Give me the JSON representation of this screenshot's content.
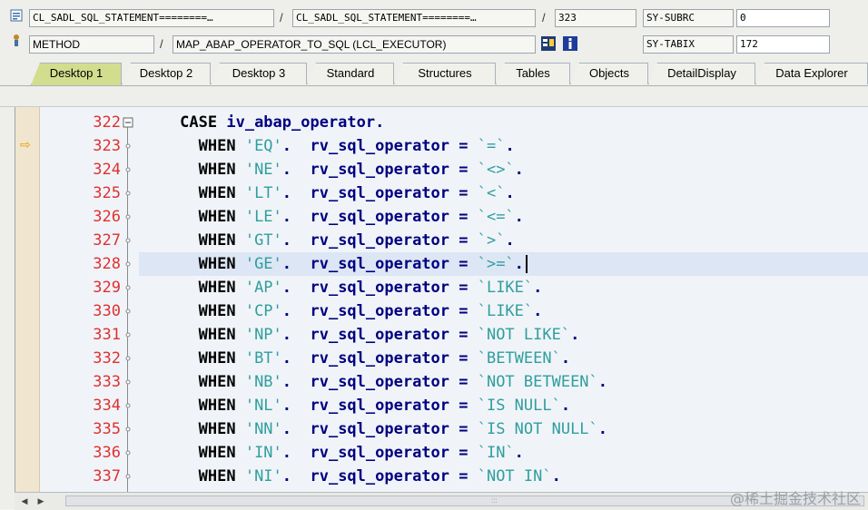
{
  "header": {
    "row1": {
      "program": "CL_SADL_SQL_STATEMENT========…",
      "include": "CL_SADL_SQL_STATEMENT========…",
      "line": "323",
      "var_name": "SY-SUBRC",
      "var_value": "0"
    },
    "row2": {
      "event_type": "METHOD",
      "event_name": "MAP_ABAP_OPERATOR_TO_SQL (LCL_EXECUTOR)",
      "var_name": "SY-TABIX",
      "var_value": "172"
    }
  },
  "tabs": [
    {
      "label": "Desktop 1",
      "active": true
    },
    {
      "label": "Desktop 2"
    },
    {
      "label": "Desktop 3"
    },
    {
      "label": "Standard"
    },
    {
      "label": "Structures"
    },
    {
      "label": "Tables"
    },
    {
      "label": "Objects"
    },
    {
      "label": "DetailDisplay"
    },
    {
      "label": "Data Explorer"
    }
  ],
  "code": {
    "lines": [
      {
        "num": "322",
        "pre": "CASE iv_abap_operator.",
        "lit": "",
        "post": ""
      },
      {
        "num": "323",
        "pre": "  WHEN ",
        "lit": "'EQ'",
        "post": ".  rv_sql_operator = ",
        "lit2": "`=`",
        "end": "."
      },
      {
        "num": "324",
        "pre": "  WHEN ",
        "lit": "'NE'",
        "post": ".  rv_sql_operator = ",
        "lit2": "`<>`",
        "end": "."
      },
      {
        "num": "325",
        "pre": "  WHEN ",
        "lit": "'LT'",
        "post": ".  rv_sql_operator = ",
        "lit2": "`<`",
        "end": "."
      },
      {
        "num": "326",
        "pre": "  WHEN ",
        "lit": "'LE'",
        "post": ".  rv_sql_operator = ",
        "lit2": "`<=`",
        "end": "."
      },
      {
        "num": "327",
        "pre": "  WHEN ",
        "lit": "'GT'",
        "post": ".  rv_sql_operator = ",
        "lit2": "`>`",
        "end": "."
      },
      {
        "num": "328",
        "pre": "  WHEN ",
        "lit": "'GE'",
        "post": ".  rv_sql_operator = ",
        "lit2": "`>=`",
        "end": "."
      },
      {
        "num": "329",
        "pre": "  WHEN ",
        "lit": "'AP'",
        "post": ".  rv_sql_operator = ",
        "lit2": "`LIKE`",
        "end": "."
      },
      {
        "num": "330",
        "pre": "  WHEN ",
        "lit": "'CP'",
        "post": ".  rv_sql_operator = ",
        "lit2": "`LIKE`",
        "end": "."
      },
      {
        "num": "331",
        "pre": "  WHEN ",
        "lit": "'NP'",
        "post": ".  rv_sql_operator = ",
        "lit2": "`NOT LIKE`",
        "end": "."
      },
      {
        "num": "332",
        "pre": "  WHEN ",
        "lit": "'BT'",
        "post": ".  rv_sql_operator = ",
        "lit2": "`BETWEEN`",
        "end": "."
      },
      {
        "num": "333",
        "pre": "  WHEN ",
        "lit": "'NB'",
        "post": ".  rv_sql_operator = ",
        "lit2": "`NOT BETWEEN`",
        "end": "."
      },
      {
        "num": "334",
        "pre": "  WHEN ",
        "lit": "'NL'",
        "post": ".  rv_sql_operator = ",
        "lit2": "`IS NULL`",
        "end": "."
      },
      {
        "num": "335",
        "pre": "  WHEN ",
        "lit": "'NN'",
        "post": ".  rv_sql_operator = ",
        "lit2": "`IS NOT NULL`",
        "end": "."
      },
      {
        "num": "336",
        "pre": "  WHEN ",
        "lit": "'IN'",
        "post": ".  rv_sql_operator = ",
        "lit2": "`IN`",
        "end": "."
      },
      {
        "num": "337",
        "pre": "  WHEN ",
        "lit": "'NI'",
        "post": ".  rv_sql_operator = ",
        "lit2": "`NOT IN`",
        "end": "."
      }
    ],
    "current_line": "323",
    "highlighted_line": "328"
  },
  "watermark": "@稀土掘金技术社区",
  "icons": {
    "program": "program-icon",
    "method": "method-icon",
    "display_object": "display-object-icon",
    "info": "info-icon",
    "current_line": "current-line-arrow-icon"
  },
  "colors": {
    "active_tab": "#d3dd8e",
    "line_number": "#e03030",
    "keyword": "#000000",
    "identifier": "#000080",
    "literal": "#2f9e9e",
    "highlight": "#dce6f4"
  }
}
